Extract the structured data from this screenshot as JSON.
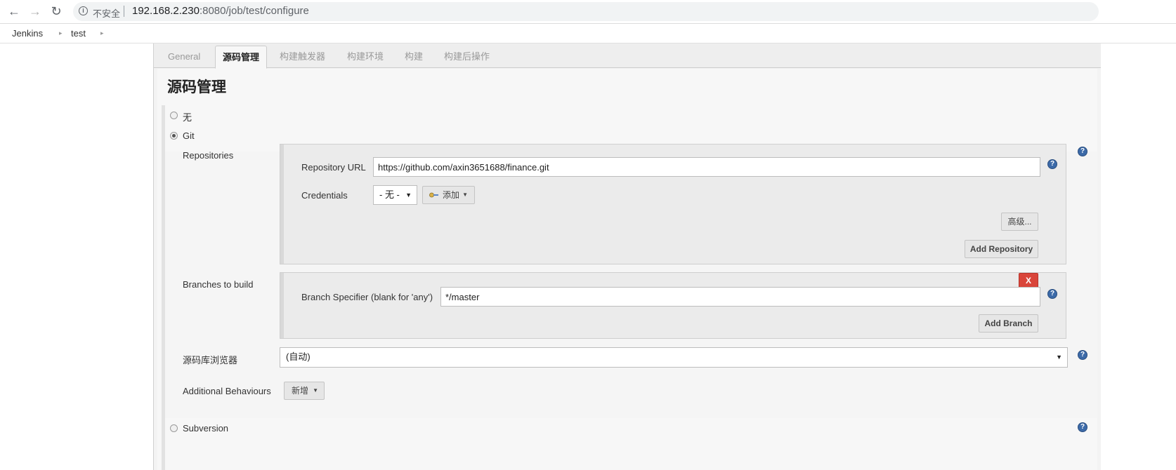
{
  "browser": {
    "security_label": "不安全",
    "url_host": "192.168.2.230",
    "url_rest": ":8080/job/test/configure"
  },
  "breadcrumb": {
    "items": [
      {
        "label": "Jenkins"
      },
      {
        "label": "test"
      }
    ]
  },
  "tabs": [
    {
      "label": "General"
    },
    {
      "label": "源码管理"
    },
    {
      "label": "构建触发器"
    },
    {
      "label": "构建环境"
    },
    {
      "label": "构建"
    },
    {
      "label": "构建后操作"
    }
  ],
  "active_tab": "源码管理",
  "section": {
    "title": "源码管理"
  },
  "scm": {
    "options": [
      {
        "label": "无",
        "checked": false
      },
      {
        "label": "Git",
        "checked": true
      },
      {
        "label": "Subversion",
        "checked": false
      }
    ]
  },
  "git": {
    "repositories_label": "Repositories",
    "repo_url_label": "Repository URL",
    "repo_url_value": "https://github.com/axin3651688/finance.git",
    "credentials_label": "Credentials",
    "credentials_value": "- 无 -",
    "add_credentials_label": "添加",
    "advanced_label": "高级...",
    "add_repository_label": "Add Repository",
    "branches_label": "Branches to build",
    "branch_specifier_label": "Branch Specifier (blank for 'any')",
    "branch_specifier_value": "*/master",
    "delete_branch_label": "X",
    "add_branch_label": "Add Branch",
    "repo_browser_label": "源码库浏览器",
    "repo_browser_value": "(自动)",
    "additional_behaviours_label": "Additional Behaviours",
    "add_behaviour_label": "新增"
  },
  "help_glyph": "?",
  "colors": {
    "delete_button": "#d9453a",
    "help_icon": "#3c6aa8"
  }
}
